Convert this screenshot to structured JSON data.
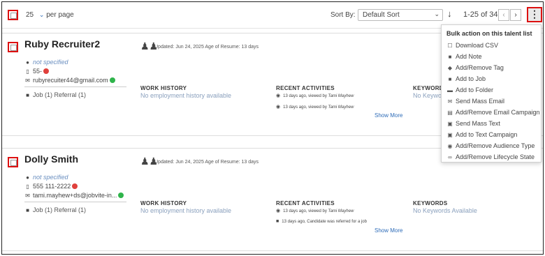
{
  "toolbar": {
    "per_page_value": "25",
    "per_page_label": "per page",
    "sort_label": "Sort By:",
    "sort_value": "Default Sort",
    "page_info": "1-25 of 34"
  },
  "candidates": [
    {
      "name": "Ruby Recruiter2",
      "location": "not specified",
      "phone": "55-",
      "email": "rubyrecuiter44@gmail.com",
      "job_ref": "Job (1)  Referral (1)",
      "updated": "Updated: Jun 24, 2025  Age of Resume: 13 days",
      "work_history_label": "WORK HISTORY",
      "work_history_value": "No employment history available",
      "recent_label": "RECENT ACTIVITIES",
      "activities": [
        {
          "text": "13 days ago, viewed by ",
          "who": "Tami Mayhew"
        },
        {
          "text": "13 days ago, viewed by ",
          "who": "Tami Mayhew"
        }
      ],
      "keywords_label": "KEYWORDS",
      "keywords_value": "No Keywords Available",
      "show_more": "Show More"
    },
    {
      "name": "Dolly Smith",
      "location": "not specified",
      "phone": "555 111-2222",
      "email": "tami.mayhew+ds@jobvite-in...",
      "job_ref": "Job (1)  Referral (1)",
      "updated": "Updated: Jun 24, 2025  Age of Resume: 13 days",
      "work_history_label": "WORK HISTORY",
      "work_history_value": "No employment history available",
      "recent_label": "RECENT ACTIVITIES",
      "activities": [
        {
          "text": "13 days ago, viewed by ",
          "who": "Tami Mayhew"
        },
        {
          "text": "13 days ago, Candidate was referred for a job",
          "who": ""
        }
      ],
      "keywords_label": "KEYWORDS",
      "keywords_value": "No Keywords Available",
      "show_more": "Show More"
    }
  ],
  "bulk_menu": {
    "title": "Bulk action on this talent list",
    "items": [
      {
        "label": "Download CSV",
        "icon": "download-icon"
      },
      {
        "label": "Add Note",
        "icon": "note-icon"
      },
      {
        "label": "Add/Remove Tag",
        "icon": "tag-icon"
      },
      {
        "label": "Add to Job",
        "icon": "briefcase-icon"
      },
      {
        "label": "Add to Folder",
        "icon": "folder-icon"
      },
      {
        "label": "Send Mass Email",
        "icon": "email-icon"
      },
      {
        "label": "Add/Remove Email Campaign",
        "icon": "campaign-icon"
      },
      {
        "label": "Send Mass Text",
        "icon": "text-message-icon"
      },
      {
        "label": "Add to Text Campaign",
        "icon": "text-campaign-icon"
      },
      {
        "label": "Add/Remove Audience Type",
        "icon": "audience-icon"
      },
      {
        "label": "Add/Remove Lifecycle State",
        "icon": "lifecycle-icon"
      }
    ]
  },
  "colors": {
    "highlight_border": "#dd1111",
    "link_blue": "#2e6cb8",
    "muted_blue": "#8aa0bd",
    "badge_red": "#e0403c",
    "badge_green": "#2fb44b"
  }
}
